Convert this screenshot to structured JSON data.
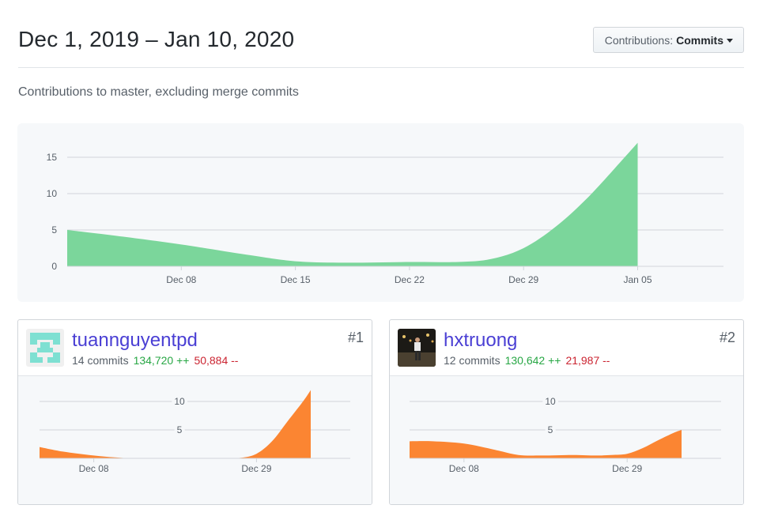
{
  "header": {
    "title": "Dec 1, 2019 – Jan 10, 2020",
    "contributions_label": "Contributions:",
    "contributions_value": "Commits"
  },
  "subtitle": "Contributions to master, excluding merge commits",
  "colors": {
    "main_fill": "#7bd69b",
    "contributor_fill": "#fb8532",
    "link": "#4a3fd4",
    "additions": "#28a745",
    "deletions": "#cb2431"
  },
  "chart_data": [
    {
      "type": "area",
      "title": "",
      "x_ticks": [
        "Dec 08",
        "Dec 15",
        "Dec 22",
        "Dec 29",
        "Jan 05"
      ],
      "y_ticks": [
        "0",
        "5",
        "10",
        "15"
      ],
      "ylim": [
        0,
        17.5
      ],
      "series": [
        {
          "x": [
            "Dec 01",
            "Dec 04",
            "Dec 08",
            "Dec 12",
            "Dec 15",
            "Dec 18",
            "Dec 22",
            "Dec 25",
            "Dec 27",
            "Dec 29",
            "Dec 31",
            "Jan 02",
            "Jan 04",
            "Jan 05"
          ],
          "values": [
            5,
            4.2,
            3,
            1.6,
            0.7,
            0.5,
            0.6,
            0.6,
            1.0,
            2.5,
            5.5,
            9.6,
            14.5,
            17
          ]
        }
      ]
    },
    {
      "type": "area",
      "contributor": "tuannguyentpd",
      "x_ticks": [
        "Dec 08",
        "Dec 29"
      ],
      "y_ticks": [
        "5",
        "10"
      ],
      "ylim": [
        0,
        12
      ],
      "series": [
        {
          "x": [
            "Dec 01",
            "Dec 04",
            "Dec 08",
            "Dec 12",
            "Dec 15",
            "Dec 18",
            "Dec 22",
            "Dec 25",
            "Dec 27",
            "Dec 29",
            "Dec 31",
            "Jan 02",
            "Jan 04",
            "Jan 05"
          ],
          "values": [
            2,
            1.2,
            0.5,
            0.05,
            0,
            0,
            0,
            0,
            0.1,
            0.8,
            3,
            6.5,
            10,
            12
          ]
        }
      ]
    },
    {
      "type": "area",
      "contributor": "hxtruong",
      "x_ticks": [
        "Dec 08",
        "Dec 29"
      ],
      "y_ticks": [
        "5",
        "10"
      ],
      "ylim": [
        0,
        12
      ],
      "series": [
        {
          "x": [
            "Dec 01",
            "Dec 04",
            "Dec 08",
            "Dec 12",
            "Dec 15",
            "Dec 18",
            "Dec 22",
            "Dec 25",
            "Dec 27",
            "Dec 29",
            "Dec 31",
            "Jan 02",
            "Jan 04",
            "Jan 05"
          ],
          "values": [
            3,
            3,
            2.6,
            1.5,
            0.6,
            0.5,
            0.6,
            0.5,
            0.6,
            0.8,
            1.8,
            3.2,
            4.5,
            5
          ]
        }
      ]
    }
  ],
  "contributors": [
    {
      "name": "tuannguyentpd",
      "commits": "14 commits",
      "additions": "134,720 ++",
      "deletions": "50,884 --",
      "rank": "#1",
      "avatar": "identicon"
    },
    {
      "name": "hxtruong",
      "commits": "12 commits",
      "additions": "130,642 ++",
      "deletions": "21,987 --",
      "rank": "#2",
      "avatar": "photo"
    }
  ]
}
